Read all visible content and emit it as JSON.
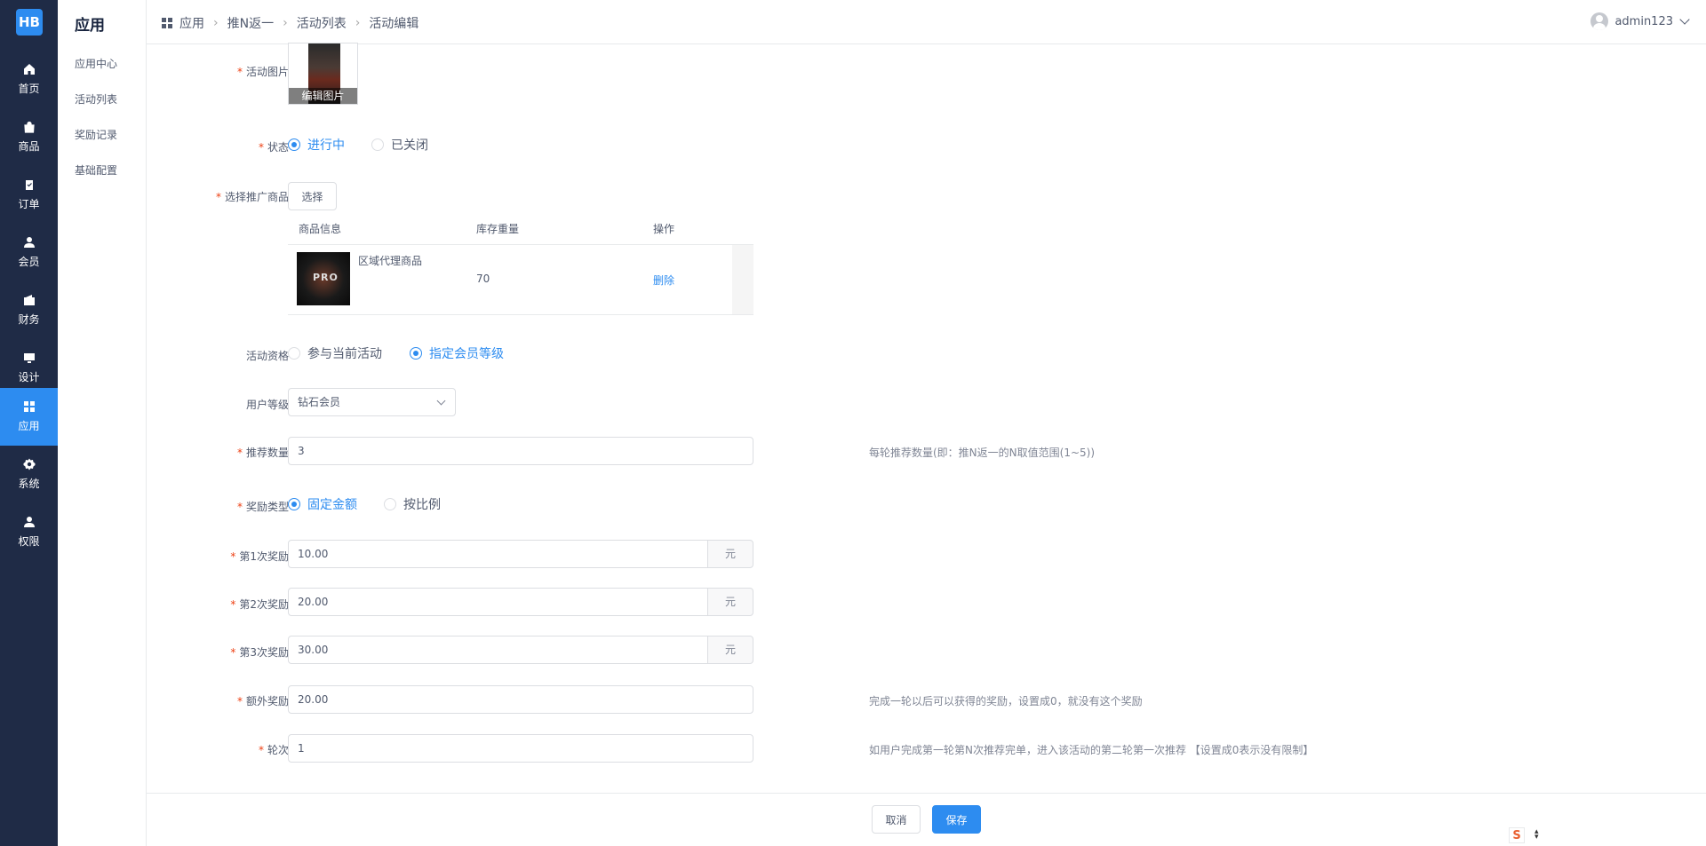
{
  "logo": {
    "text": "HB"
  },
  "nav": [
    "首页",
    "商品",
    "订单",
    "会员",
    "财务",
    "设计",
    "应用",
    "系统",
    "权限"
  ],
  "subnav": {
    "title": "应用",
    "items": [
      "应用中心",
      "活动列表",
      "奖励记录",
      "基础配置"
    ]
  },
  "breadcrumb": [
    "应用",
    "推N返一",
    "活动列表",
    "活动编辑"
  ],
  "user": {
    "name": "admin123"
  },
  "form": {
    "image_label": "活动图片",
    "image_caption": "编辑图片",
    "status_label": "状态",
    "status_on": "进行中",
    "status_off": "已关闭",
    "product_label": "选择推广商品",
    "select_button": "选择",
    "table_headers": [
      "商品信息",
      "库存重量",
      "操作"
    ],
    "product": {
      "name": "区域代理商品",
      "stock": "70",
      "action": "删除",
      "thumb_text": "PRO"
    },
    "qual_label": "活动资格",
    "qual_all": "参与当前活动",
    "qual_level": "指定会员等级",
    "level_label": "用户等级",
    "level_value": "钻石会员",
    "count_label": "推荐数量",
    "count_value": "3",
    "count_hint": "每轮推荐数量(即：推N返一的N取值范围(1~5))",
    "reward_type_label": "奖励类型",
    "reward_fixed": "固定金额",
    "reward_ratio": "按比例",
    "reward1_label": "第1次奖励",
    "reward1_value": "10.00",
    "reward2_label": "第2次奖励",
    "reward2_value": "20.00",
    "reward3_label": "第3次奖励",
    "reward3_value": "30.00",
    "unit": "元",
    "extra_label": "额外奖励",
    "extra_value": "20.00",
    "extra_hint": "完成一轮以后可以获得的奖励，设置成0，就没有这个奖励",
    "round_label": "轮次",
    "round_value": "1",
    "round_hint": "如用户完成第一轮第N次推荐完单，进入该活动的第二轮第一次推荐 【设置成0表示没有限制】"
  },
  "footer": {
    "cancel": "取消",
    "save": "保存"
  },
  "colors": {
    "sidebar": "#1f2b46",
    "primary": "#2d8cf0",
    "required": "#ed4014"
  }
}
